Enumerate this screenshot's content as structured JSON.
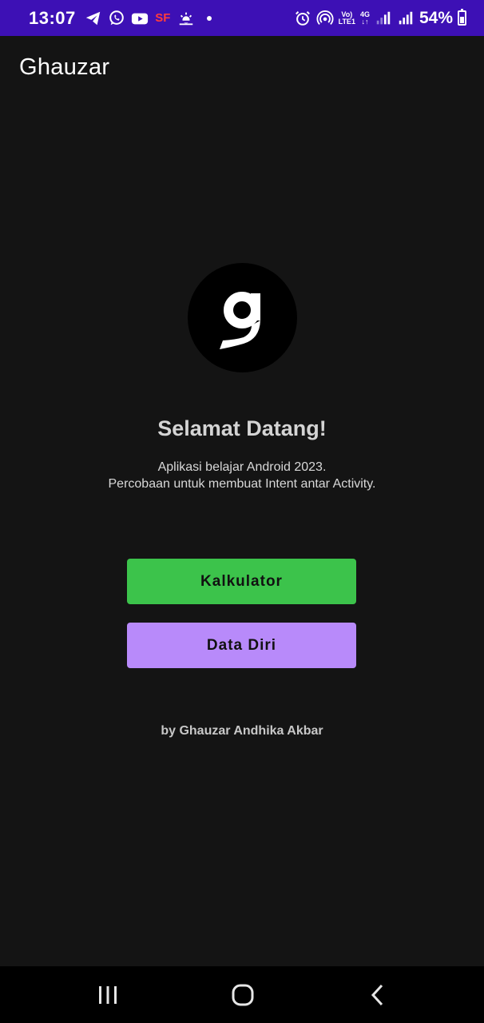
{
  "status_bar": {
    "time": "13:07",
    "left_icons": [
      "telegram-icon",
      "whatsapp-icon",
      "youtube-icon",
      "sf-icon",
      "weather-icon",
      "notification-dot"
    ],
    "sf_label": "SF",
    "right_icons": [
      "alarm-icon",
      "hotspot-icon",
      "volte-icon",
      "4g-icon",
      "signal-icon",
      "signal-icon-2",
      "battery-icon"
    ],
    "volte_top": "Vo)",
    "volte_bottom": "LTE1",
    "net_top": "4G",
    "net_bottom": "↓↑",
    "battery_percent": "54%",
    "battery_level": 0.54
  },
  "app_bar": {
    "title": "Ghauzar"
  },
  "main": {
    "logo_icon": "g-logo-icon",
    "welcome": "Selamat Datang!",
    "description_line1": "Aplikasi belajar Android 2023.",
    "description_line2": "Percobaan untuk membuat Intent antar Activity.",
    "buttons": [
      {
        "label": "Kalkulator",
        "color": "#3cc34b"
      },
      {
        "label": "Data Diri",
        "color": "#b88afa"
      }
    ],
    "byline": "by Ghauzar Andhika Akbar"
  },
  "nav_bar": {
    "items": [
      "recent-apps-icon",
      "home-icon",
      "back-icon"
    ]
  },
  "colors": {
    "status_bar": "#3d10b5",
    "background": "#141414",
    "nav_bar": "#000000"
  }
}
